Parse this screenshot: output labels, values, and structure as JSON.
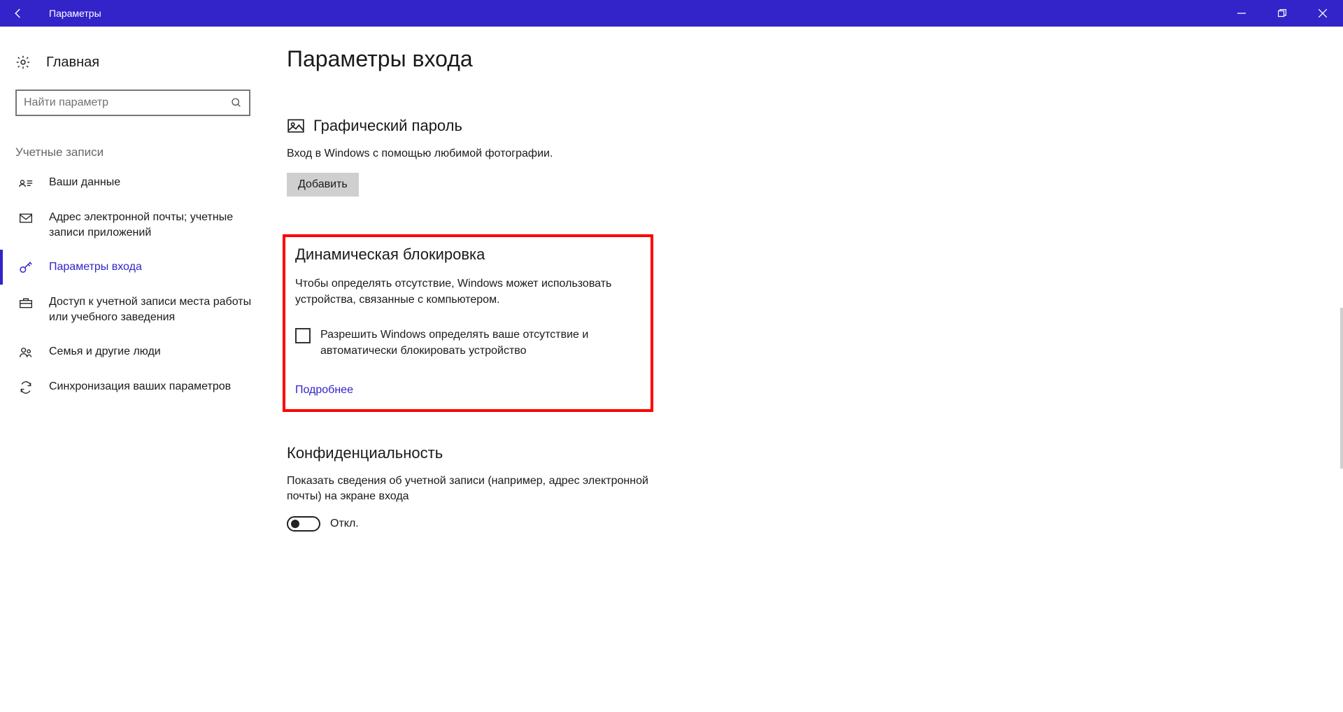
{
  "titlebar": {
    "title": "Параметры"
  },
  "sidebar": {
    "home": "Главная",
    "search_placeholder": "Найти параметр",
    "category": "Учетные записи",
    "items": [
      {
        "label": "Ваши данные"
      },
      {
        "label": "Адрес электронной почты; учетные записи приложений"
      },
      {
        "label": "Параметры входа"
      },
      {
        "label": "Доступ к учетной записи места работы или учебного заведения"
      },
      {
        "label": "Семья и другие люди"
      },
      {
        "label": "Синхронизация ваших параметров"
      }
    ]
  },
  "main": {
    "page_title": "Параметры входа",
    "picture_password": {
      "heading": "Графический пароль",
      "desc": "Вход в Windows с помощью любимой фотографии.",
      "button": "Добавить"
    },
    "dynamic_lock": {
      "heading": "Динамическая блокировка",
      "desc": "Чтобы определять отсутствие, Windows может использовать устройства, связанные с компьютером.",
      "checkbox_label": "Разрешить Windows определять ваше отсутствие и автоматически блокировать устройство",
      "more": "Подробнее"
    },
    "privacy": {
      "heading": "Конфиденциальность",
      "desc": "Показать сведения об учетной записи (например, адрес электронной почты) на экране входа",
      "toggle_state": "Откл."
    }
  }
}
